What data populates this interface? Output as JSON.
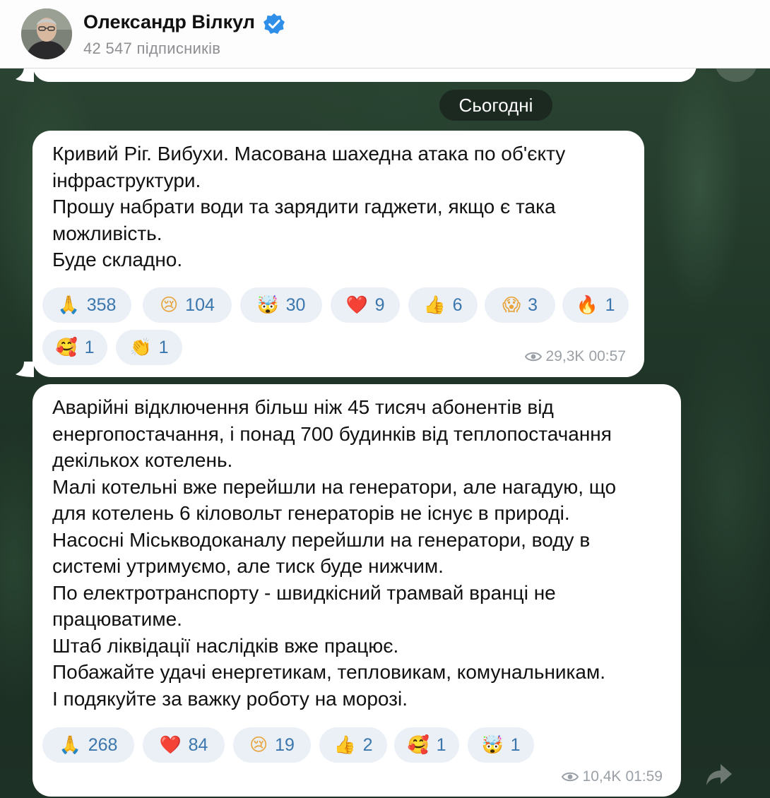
{
  "channel": {
    "name": "Олександр Вілкул",
    "subscribers": "42 547 підписників",
    "verified_icon": "verified-badge-icon"
  },
  "date_divider": "Сьогодні",
  "messages": [
    {
      "lines": [
        "Кривий Ріг. Вибухи. Масована шахедна атака по об'єкту",
        "інфраструктури.",
        "Прошу набрати води та зарядити гаджети, якщо є така",
        "можливість.",
        "Буде складно."
      ],
      "reactions": [
        {
          "emoji": "🙏",
          "icon": "folded-hands-icon",
          "count": "358"
        },
        {
          "emoji": "😢",
          "icon": "crying-face-icon",
          "count": "104"
        },
        {
          "emoji": "🤯",
          "icon": "exploding-head-icon",
          "count": "30"
        },
        {
          "emoji": "❤️",
          "icon": "red-heart-icon",
          "count": "9"
        },
        {
          "emoji": "👍",
          "icon": "thumbs-up-icon",
          "count": "6"
        },
        {
          "emoji": "😱",
          "icon": "screaming-face-icon",
          "count": "3"
        },
        {
          "emoji": "🔥",
          "icon": "fire-icon",
          "count": "1"
        },
        {
          "emoji": "🥰",
          "icon": "smiling-face-hearts-icon",
          "count": "1"
        },
        {
          "emoji": "👏",
          "icon": "clapping-hands-icon",
          "count": "1"
        }
      ],
      "views": "29,3K",
      "time": "00:57"
    },
    {
      "lines": [
        "Аварійні відключення більш ніж 45 тисяч абонентів від",
        "енергопостачання, і понад 700 будинків від теплопостачання",
        "декількох котелень.",
        "Малі котельні вже перейшли на генератори, але нагадую, що",
        "для котелень 6 кіловольт генераторів не існує в природі.",
        "Насосні Міськводоканалу перейшли на генератори, воду в",
        "системі утримуємо, але тиск буде нижчим.",
        "По електротранспорту - швидкісний трамвай вранці не",
        "працюватиме.",
        "Штаб ліквідації наслідків вже працює.",
        "Побажайте удачі енергетикам, тепловикам, комунальникам.",
        "І подякуйте за важку роботу на морозі."
      ],
      "reactions": [
        {
          "emoji": "🙏",
          "icon": "folded-hands-icon",
          "count": "268"
        },
        {
          "emoji": "❤️",
          "icon": "red-heart-icon",
          "count": "84"
        },
        {
          "emoji": "😢",
          "icon": "crying-face-icon",
          "count": "19"
        },
        {
          "emoji": "👍",
          "icon": "thumbs-up-icon",
          "count": "2"
        },
        {
          "emoji": "🥰",
          "icon": "smiling-face-hearts-icon",
          "count": "1"
        },
        {
          "emoji": "🤯",
          "icon": "exploding-head-icon",
          "count": "1"
        }
      ],
      "views": "10,4K",
      "time": "01:59"
    }
  ],
  "colors": {
    "accent": "#3b76ad",
    "verified": "#2f8ee8",
    "reaction_bg": "#eaf0f5",
    "meta": "#9aa0a6"
  }
}
